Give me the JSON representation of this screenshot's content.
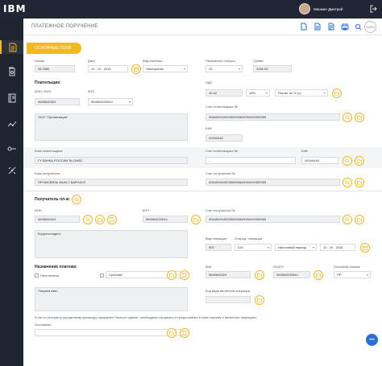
{
  "app": {
    "logo": "IBM",
    "user_name": "Мишкин Дмитрий"
  },
  "page": {
    "title": "ПЛАТЕЖНОЕ ПОРУЧЕНИЕ",
    "tab": "ОСНОВНЫЕ ПОЛЯ",
    "zoom": "100%"
  },
  "header": {
    "number_label": "Номер",
    "number": "№ 2586",
    "date_label": "Дата",
    "date": "12 . 10 . 2016",
    "paytype_label": "Вид платежа",
    "paytype": "Электронно",
    "status_label": "Показатель статуса",
    "status": "13",
    "sum_label": "Сумма",
    "sum": "3256.00"
  },
  "payer": {
    "section": "Плательщик:",
    "inn_label": "ИНН / КИО",
    "inn": "5645645324",
    "kpp_label": "КПП",
    "kpp": "564564532644",
    "name": "ООО \"Организация\"",
    "nds_label": "НДС",
    "nds": "49.42",
    "nds_pct": "18%",
    "nds_calc": "Расчет по % (с)",
    "account_label": "Счет плательщика №",
    "account": "90849090490350990849090490350959",
    "bik_label": "БИК",
    "bik": "09340445"
  },
  "payer_bank": {
    "bank_label": "Банк плательщика",
    "bank": "ГУ БАНКА РОССИИ № 10462",
    "acc_label": "Счет плательщика №",
    "acc": "...",
    "bik_label": "БИК",
    "bik": "09340445"
  },
  "payee_bank": {
    "bank_label": "Банк получателя",
    "bank": "ПРОМСВЯЗЬ БАНК Г.БАРНАУЛ",
    "acc_label": "Счет получателя №",
    "acc": "90849090490350990849090490350959"
  },
  "payee": {
    "section": "Получатель пл-ж:",
    "inn_label": "ИНН",
    "inn": "5645645324",
    "kpp_label": "КПП",
    "kpp": "564564532644",
    "acc_label": "Счет получателя №",
    "acc": "90849090490350990849090490350959",
    "name": "Корреспондент",
    "optype_label": "Вид операции",
    "optype": "900",
    "queue_label": "Очеред. операции",
    "queue": "234",
    "period": "Налоговый период",
    "period_date": "12 . 10 . 2016"
  },
  "purpose": {
    "section": "Назначение платежа:",
    "no_tax": "Неоплачены",
    "tax_type": "Срочный",
    "kbk_label": "КБК",
    "kbk": "5645645324",
    "okato_label": "ОКАТО",
    "okato": "564564532644",
    "basis_label": "Основной платеж",
    "basis": "ПР",
    "text": "Покупка авто",
    "currency_label": "Код вида валютной операции"
  },
  "footer": {
    "note": "Если по контракту (кредитному договору) оформлен Паспорт сделки, необходимо оформить и предоставить в Банк справку о валютных операциях.",
    "basis_label": "Основания"
  }
}
